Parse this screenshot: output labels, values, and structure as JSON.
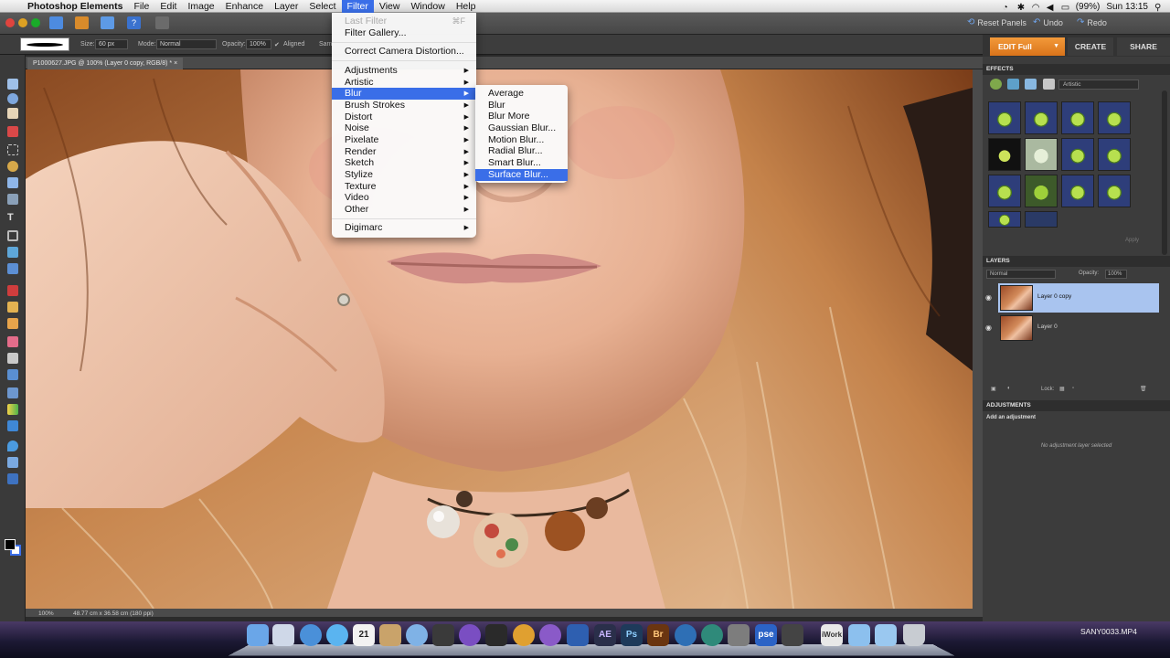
{
  "menubar": {
    "app_name": "Photoshop Elements",
    "items": [
      "File",
      "Edit",
      "Image",
      "Enhance",
      "Layer",
      "Select",
      "Filter",
      "View",
      "Window",
      "Help"
    ],
    "active_item": "Filter",
    "battery": "(99%)",
    "clock": "Sun 13:15"
  },
  "toolbar": {
    "reset_panels": "Reset Panels",
    "undo": "Undo",
    "redo": "Redo"
  },
  "options": {
    "size_label": "Size:",
    "size_value": "60 px",
    "mode_label": "Mode:",
    "mode_value": "Normal",
    "opacity_label": "Opacity:",
    "opacity_value": "100%",
    "aligned_label": "Aligned",
    "sample_label": "Sam"
  },
  "modes": {
    "edit_full": "EDIT Full",
    "create": "CREATE",
    "share": "SHARE"
  },
  "document": {
    "tab_title": "P1000627.JPG @ 100% (Layer 0 copy, RGB/8) *",
    "zoom": "100%",
    "dimensions": "48.77 cm x 36.58 cm (180 ppi)"
  },
  "filter_menu": {
    "items": [
      {
        "label": "Last Filter",
        "shortcut": "⌘F",
        "disabled": true
      },
      {
        "label": "Filter Gallery...",
        "disabled": false
      },
      {
        "label": "Correct Camera Distortion...",
        "disabled": false
      },
      {
        "label": "Adjustments",
        "submenu": true
      },
      {
        "label": "Artistic",
        "submenu": true
      },
      {
        "label": "Blur",
        "submenu": true,
        "highlighted": true
      },
      {
        "label": "Brush Strokes",
        "submenu": true
      },
      {
        "label": "Distort",
        "submenu": true
      },
      {
        "label": "Noise",
        "submenu": true
      },
      {
        "label": "Pixelate",
        "submenu": true
      },
      {
        "label": "Render",
        "submenu": true
      },
      {
        "label": "Sketch",
        "submenu": true
      },
      {
        "label": "Stylize",
        "submenu": true
      },
      {
        "label": "Texture",
        "submenu": true
      },
      {
        "label": "Video",
        "submenu": true
      },
      {
        "label": "Other",
        "submenu": true
      },
      {
        "label": "Digimarc",
        "submenu": true
      }
    ]
  },
  "blur_submenu": {
    "items": [
      "Average",
      "Blur",
      "Blur More",
      "Gaussian Blur...",
      "Motion Blur...",
      "Radial Blur...",
      "Smart Blur...",
      "Surface Blur..."
    ],
    "highlighted": "Surface Blur..."
  },
  "effects_panel": {
    "title": "EFFECTS",
    "category": "Artistic",
    "apply_label": "Apply",
    "thumbnail_count": 14
  },
  "layers_panel": {
    "title": "LAYERS",
    "blend_mode": "Normal",
    "opacity_label": "Opacity:",
    "opacity_value": "100%",
    "layers": [
      {
        "name": "Layer 0 copy",
        "selected": true
      },
      {
        "name": "Layer 0",
        "selected": false
      }
    ],
    "lock_label": "Lock:"
  },
  "adjustments_panel": {
    "title": "ADJUSTMENTS",
    "add_label": "Add an adjustment",
    "empty_label": "No adjustment layer selected"
  },
  "dock": {
    "items": [
      "finder",
      "preview",
      "safari",
      "ichat",
      "ical",
      "photos",
      "itunes",
      "imovie",
      "photoshop-icon",
      "final-cut",
      "chrome",
      "dvd",
      "ae",
      "ps",
      "br",
      "globe",
      "time-machine",
      "bridge-sq",
      "pse",
      "clapper",
      "iwork",
      "folder-1",
      "folder-2",
      "trash"
    ],
    "calendar_day": "21",
    "ae_label": "AE",
    "ps_label": "Ps",
    "br_label": "Br",
    "pse_label": "pse",
    "iwork_label": "iWork",
    "video_label": "SANY0033.MP4"
  }
}
